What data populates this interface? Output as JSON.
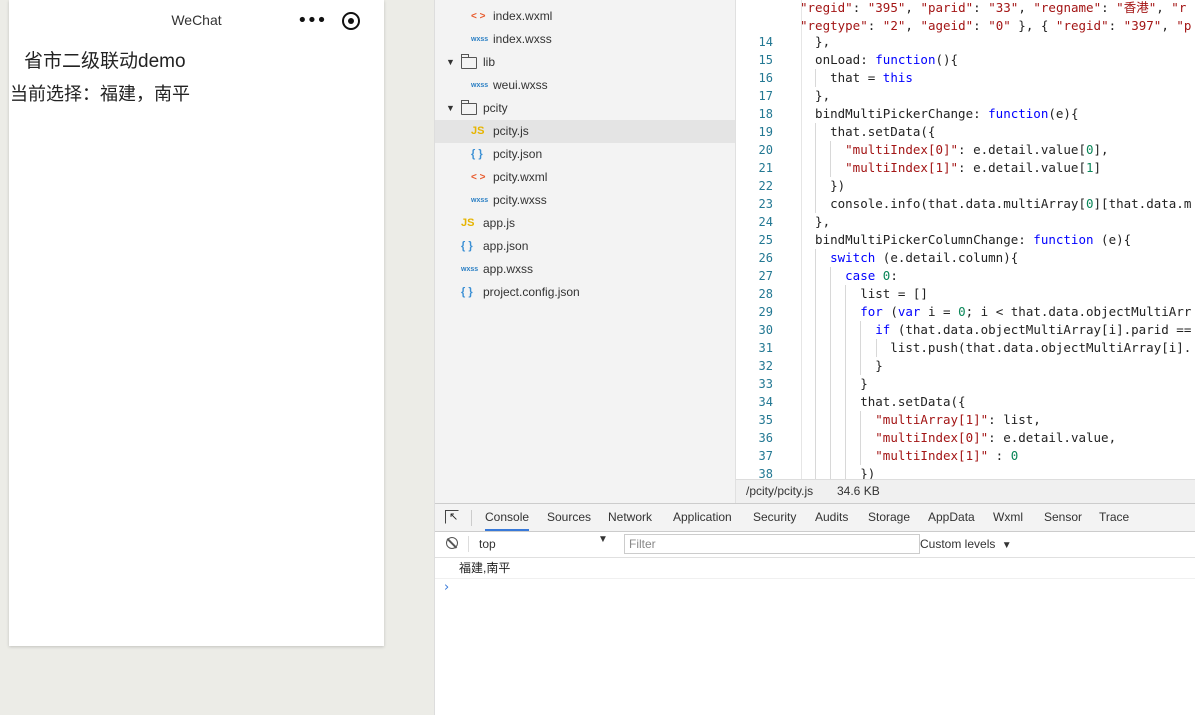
{
  "simulator": {
    "title": "WeChat",
    "menu_glyph": "•••",
    "heading": "省市二级联动demo",
    "current_selection": "当前选择：福建，南平"
  },
  "file_tree": [
    {
      "label": "index.wxml",
      "icon": "wxml",
      "indent": 2
    },
    {
      "label": "index.wxss",
      "icon": "wxss",
      "indent": 2
    },
    {
      "label": "lib",
      "icon": "folder",
      "indent": 1
    },
    {
      "label": "weui.wxss",
      "icon": "wxss",
      "indent": 2
    },
    {
      "label": "pcity",
      "icon": "folder",
      "indent": 1
    },
    {
      "label": "pcity.js",
      "icon": "js",
      "indent": 2,
      "selected": true
    },
    {
      "label": "pcity.json",
      "icon": "json",
      "indent": 2
    },
    {
      "label": "pcity.wxml",
      "icon": "wxml",
      "indent": 2
    },
    {
      "label": "pcity.wxss",
      "icon": "wxss",
      "indent": 2
    },
    {
      "label": "app.js",
      "icon": "js",
      "indent": 1
    },
    {
      "label": "app.json",
      "icon": "json",
      "indent": 1
    },
    {
      "label": "app.wxss",
      "icon": "wxss",
      "indent": 1
    },
    {
      "label": "project.config.json",
      "icon": "json",
      "indent": 1
    }
  ],
  "icons": {
    "js": "JS",
    "json": "{ }",
    "wxml": "< >",
    "wxss": "wxss"
  },
  "editor": {
    "top_lines": [
      "\"regid\": \"395\", \"parid\": \"33\", \"regname\": \"香港\", \"r",
      "\"regtype\": \"2\", \"ageid\": \"0\" }, { \"regid\": \"397\", \"p"
    ],
    "lines": [
      {
        "n": "14",
        "t": "  },"
      },
      {
        "n": "15",
        "t": "  onLoad: function(){"
      },
      {
        "n": "16",
        "t": "    that = this"
      },
      {
        "n": "17",
        "t": "  },"
      },
      {
        "n": "18",
        "t": "  bindMultiPickerChange: function(e){"
      },
      {
        "n": "19",
        "t": "    that.setData({"
      },
      {
        "n": "20",
        "t": "      \"multiIndex[0]\": e.detail.value[0],"
      },
      {
        "n": "21",
        "t": "      \"multiIndex[1]\": e.detail.value[1]"
      },
      {
        "n": "22",
        "t": "    })"
      },
      {
        "n": "23",
        "t": "    console.info(that.data.multiArray[0][that.data.m"
      },
      {
        "n": "24",
        "t": "  },"
      },
      {
        "n": "25",
        "t": "  bindMultiPickerColumnChange: function (e){"
      },
      {
        "n": "26",
        "t": "    switch (e.detail.column){"
      },
      {
        "n": "27",
        "t": "      case 0:"
      },
      {
        "n": "28",
        "t": "        list = []"
      },
      {
        "n": "29",
        "t": "        for (var i = 0; i < that.data.objectMultiArr"
      },
      {
        "n": "30",
        "t": "          if (that.data.objectMultiArray[i].parid =="
      },
      {
        "n": "31",
        "t": "            list.push(that.data.objectMultiArray[i]."
      },
      {
        "n": "32",
        "t": "          }"
      },
      {
        "n": "33",
        "t": "        }"
      },
      {
        "n": "34",
        "t": "        that.setData({"
      },
      {
        "n": "35",
        "t": "          \"multiArray[1]\": list,"
      },
      {
        "n": "36",
        "t": "          \"multiIndex[0]\": e.detail.value,"
      },
      {
        "n": "37",
        "t": "          \"multiIndex[1]\" : 0"
      },
      {
        "n": "38",
        "t": "        })"
      }
    ]
  },
  "statusbar": {
    "path": "/pcity/pcity.js",
    "size": "34.6 KB"
  },
  "devtools": {
    "tabs": [
      "Console",
      "Sources",
      "Network",
      "Application",
      "Security",
      "Audits",
      "Storage",
      "AppData",
      "Wxml",
      "Sensor",
      "Trace"
    ],
    "active_tab": "Console",
    "context": "top",
    "filter_placeholder": "Filter",
    "levels": "Custom levels",
    "output": "福建,南平"
  },
  "colors": {
    "accent": "#3879d9",
    "keyword": "#0000ff",
    "string": "#a31515",
    "number": "#098658"
  }
}
